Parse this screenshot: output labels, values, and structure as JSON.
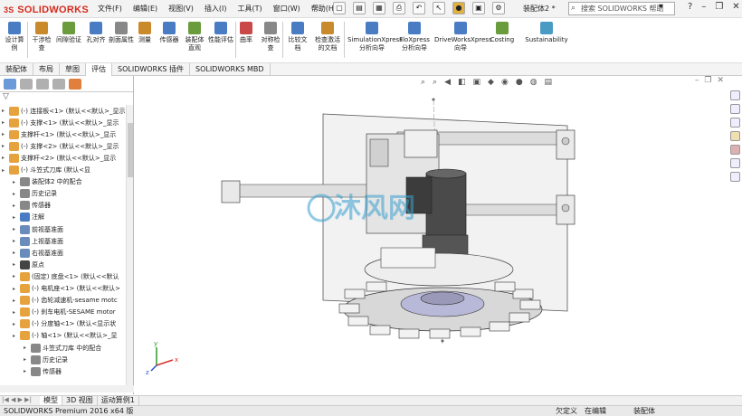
{
  "app": {
    "logo": "SOLIDWORKS",
    "logo_prefix": "3S",
    "doc_title": "装配体2 *",
    "search_placeholder": "搜索 SOLIDWORKS 帮助"
  },
  "menu": [
    "文件(F)",
    "编辑(E)",
    "视图(V)",
    "插入(I)",
    "工具(T)",
    "窗口(W)",
    "帮助(H)"
  ],
  "ribbon": {
    "buttons": [
      {
        "label": "设计算例",
        "color": "#4a7cc4"
      },
      {
        "label": "干涉检查",
        "color": "#c98a2b"
      },
      {
        "label": "间隙验证",
        "color": "#6a9b3c"
      },
      {
        "label": "孔对齐",
        "color": "#4a7cc4"
      },
      {
        "label": "剖面属性",
        "color": "#888888"
      },
      {
        "label": "测量",
        "color": "#c98a2b"
      },
      {
        "label": "传感器",
        "color": "#4a7cc4"
      },
      {
        "label": "装配体直观",
        "color": "#6a9b3c"
      },
      {
        "label": "性能评估",
        "color": "#4a7cc4"
      },
      {
        "label": "曲率",
        "color": "#c94848"
      },
      {
        "label": "对称检查",
        "color": "#888888"
      },
      {
        "label": "比较文档",
        "color": "#4a7cc4"
      },
      {
        "label": "检查激活的文档",
        "color": "#c98a2b"
      },
      {
        "label": "SimulationXpress 分析向导",
        "color": "#4a7cc4"
      },
      {
        "label": "FloXpress 分析向导",
        "color": "#4a7cc4"
      },
      {
        "label": "DriveWorksXpress 向导",
        "color": "#4a7cc4"
      },
      {
        "label": "Costing",
        "color": "#6a9b3c"
      },
      {
        "label": "Sustainability",
        "color": "#4a9bc4"
      }
    ]
  },
  "tabs": [
    "装配体",
    "布局",
    "草图",
    "评估",
    "SOLIDWORKS 插件",
    "SOLIDWORKS MBD"
  ],
  "active_tab_index": 3,
  "tree": {
    "rows": [
      {
        "label": "(-) 连接板<1> (默认<<默认>_显示",
        "indent": 0,
        "icon": "#e6a23c"
      },
      {
        "label": "(-) 支撑<1> (默认<<默认>_显示",
        "indent": 0,
        "icon": "#e6a23c"
      },
      {
        "label": "支撑杆<1> (默认<<默认>_显示",
        "indent": 0,
        "icon": "#e6a23c"
      },
      {
        "label": "(-) 支撑<2> (默认<<默认>_显示",
        "indent": 0,
        "icon": "#e6a23c"
      },
      {
        "label": "支撑杆<2> (默认<<默认>_显示",
        "indent": 0,
        "icon": "#e6a23c"
      },
      {
        "label": "(-) 斗笠式刀库 (默认<显",
        "indent": 0,
        "icon": "#e6a23c"
      },
      {
        "label": "装配体2 中的配合",
        "indent": 1,
        "icon": "#888888"
      },
      {
        "label": "历史记录",
        "indent": 1,
        "icon": "#888888"
      },
      {
        "label": "传感器",
        "indent": 1,
        "icon": "#888888"
      },
      {
        "label": "注解",
        "indent": 1,
        "icon": "#4a7cc4"
      },
      {
        "label": "前视基准面",
        "indent": 1,
        "icon": "#6a8cbc"
      },
      {
        "label": "上视基准面",
        "indent": 1,
        "icon": "#6a8cbc"
      },
      {
        "label": "右视基准面",
        "indent": 1,
        "icon": "#6a8cbc"
      },
      {
        "label": "原点",
        "indent": 1,
        "icon": "#444444"
      },
      {
        "label": "(固定) 底盘<1> (默认<<默认",
        "indent": 1,
        "icon": "#e6a23c"
      },
      {
        "label": "(-) 电机座<1> (默认<<默认>",
        "indent": 1,
        "icon": "#e6a23c"
      },
      {
        "label": "(-) 齿轮减速机-sesame motc",
        "indent": 1,
        "icon": "#e6a23c"
      },
      {
        "label": "(-) 刹车电机-SESAME motor",
        "indent": 1,
        "icon": "#e6a23c"
      },
      {
        "label": "(-) 分度轴<1> (默认<显示状",
        "indent": 1,
        "icon": "#e6a23c"
      },
      {
        "label": "(-) 轴<1> (默认<<默认>_显",
        "indent": 1,
        "icon": "#e6a23c"
      },
      {
        "label": "斗笠式刀库 中的配合",
        "indent": 2,
        "icon": "#888888"
      },
      {
        "label": "历史记录",
        "indent": 2,
        "icon": "#888888"
      },
      {
        "label": "传感器",
        "indent": 2,
        "icon": "#888888"
      }
    ]
  },
  "bottom_tabs": [
    "模型",
    "3D 视图",
    "运动算例1"
  ],
  "status": {
    "left": "SOLIDWORKS Premium 2016 x64 版",
    "undefined": "欠定义",
    "editing": "在编辑",
    "item": "装配体"
  },
  "watermark": "沐风网"
}
